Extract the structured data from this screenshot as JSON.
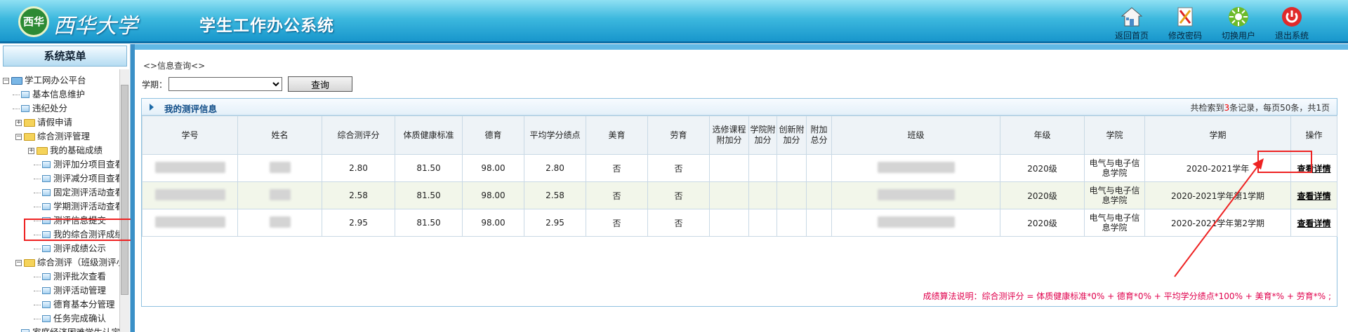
{
  "header": {
    "logo_text": "西华",
    "university": "西华大学",
    "system_name": "学生工作办公系统",
    "toolbar": [
      {
        "label": "返回首页",
        "icon": "home-icon"
      },
      {
        "label": "修改密码",
        "icon": "password-icon"
      },
      {
        "label": "切换用户",
        "icon": "switch-user-icon"
      },
      {
        "label": "退出系统",
        "icon": "power-icon"
      }
    ]
  },
  "nav": {
    "title": "系统菜单",
    "items": [
      {
        "label": "学工网办公平台"
      },
      {
        "label": "基本信息维护"
      },
      {
        "label": "违纪处分"
      },
      {
        "label": "请假申请"
      },
      {
        "label": "综合测评管理"
      },
      {
        "label": "我的基础成绩"
      },
      {
        "label": "测评加分项目查看"
      },
      {
        "label": "测评减分项目查看"
      },
      {
        "label": "固定测评活动查看"
      },
      {
        "label": "学期测评活动查看"
      },
      {
        "label": "测评信息提交"
      },
      {
        "label": "我的综合测评成绩"
      },
      {
        "label": "测评成绩公示"
      },
      {
        "label": "综合测评（班级测评小组）"
      },
      {
        "label": "测评批次查看"
      },
      {
        "label": "测评活动管理"
      },
      {
        "label": "德育基本分管理"
      },
      {
        "label": "任务完成确认"
      },
      {
        "label": "家庭经济困难学生认定"
      }
    ]
  },
  "main": {
    "breadcrumb": "<>信息查询<>",
    "term_label": "学期：",
    "term_value": "",
    "query_button": "查询",
    "panel_title": "我的测评信息",
    "count_prefix": "共检索到",
    "count_num": "3",
    "count_suffix": "条记录，每页50条，共1页",
    "columns": [
      "学号",
      "姓名",
      "综合测评分",
      "体质健康标准",
      "德育",
      "平均学分绩点",
      "美育",
      "劳育",
      "选修课程附加分",
      "学院附加分",
      "创新附加分",
      "附加总分",
      "班级",
      "年级",
      "学院",
      "学期",
      "操作"
    ],
    "rows": [
      {
        "score": "2.80",
        "health": "81.50",
        "moral": "98.00",
        "gpa": "2.80",
        "art": "否",
        "labor": "否",
        "grade": "2020级",
        "college": "电气与电子信息学院",
        "term": "2020-2021学年",
        "action": "查看详情"
      },
      {
        "score": "2.58",
        "health": "81.50",
        "moral": "98.00",
        "gpa": "2.58",
        "art": "否",
        "labor": "否",
        "grade": "2020级",
        "college": "电气与电子信息学院",
        "term": "2020-2021学年第1学期",
        "action": "查看详情"
      },
      {
        "score": "2.95",
        "health": "81.50",
        "moral": "98.00",
        "gpa": "2.95",
        "art": "否",
        "labor": "否",
        "grade": "2020级",
        "college": "电气与电子信息学院",
        "term": "2020-2021学年第2学期",
        "action": "查看详情"
      }
    ],
    "formula": "成绩算法说明：综合测评分 = 体质健康标准*0% + 德育*0% + 平均学分绩点*100% + 美育*% + 劳育*%  ;"
  },
  "colors": {
    "header": "#1896cc",
    "annotation": "#ee2222",
    "formula": "#e0004c"
  }
}
